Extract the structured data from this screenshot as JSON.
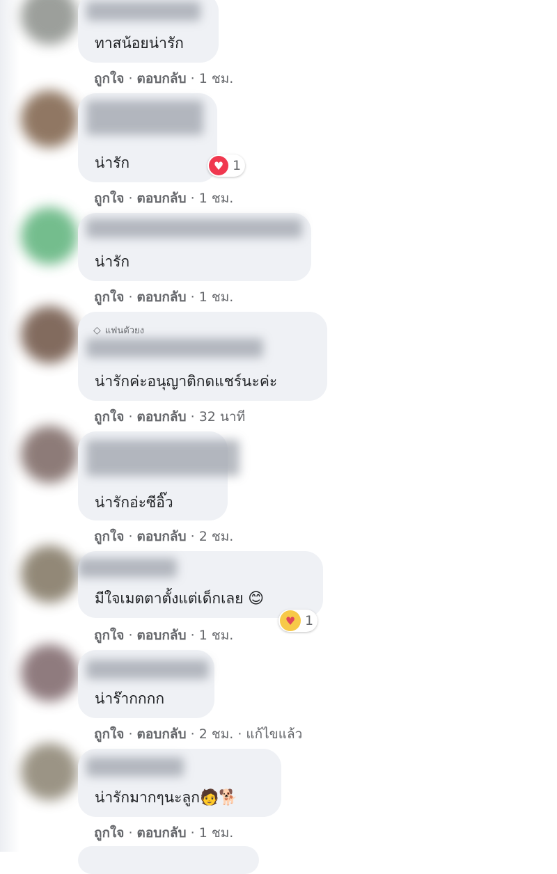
{
  "meta_labels": {
    "like": "ถูกใจ",
    "reply": "ตอบกลับ"
  },
  "fan_badge": "แฟนตัวยง",
  "comments": [
    {
      "text": "ทาสน้อยน่ารัก",
      "time": "1 ชม."
    },
    {
      "text": "น่ารัก",
      "time": "1 ชม.",
      "reaction": {
        "icon": "heart-reaction-icon",
        "count": "1"
      }
    },
    {
      "text": "น่ารัก",
      "time": "1 ชม."
    },
    {
      "text": "น่ารักค่ะอนุญาติกดแชร์นะค่ะ",
      "time": "32 นาที"
    },
    {
      "text": "น่ารักอ่ะซีอิ๊ว",
      "time": "2 ชม."
    },
    {
      "text": "มีใจเมตตาตั้งแต่เด็กเลย",
      "emoji": "😊",
      "time": "1 ชม.",
      "reaction": {
        "icon": "care-reaction-icon",
        "count": "1"
      }
    },
    {
      "text": "น่าร๊ากกกก",
      "time": "2 ชม.",
      "edited": "แก้ไขแล้ว"
    },
    {
      "text": "น่ารักมากๆนะลูก",
      "emoji": "🧑🐕",
      "time": "1 ชม."
    }
  ]
}
